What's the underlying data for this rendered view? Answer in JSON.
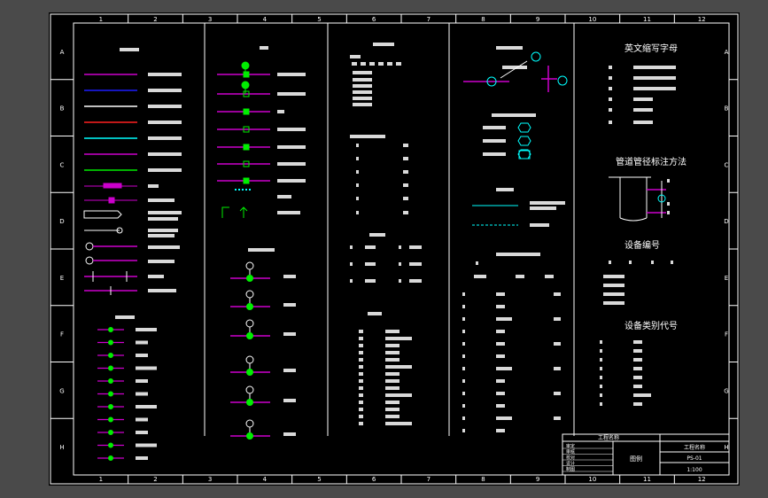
{
  "colors": {
    "background": "#000000",
    "frame": "#ffffff",
    "text": "#ffffff",
    "heading": "#ffffff",
    "magenta": "#cc00cc",
    "blue": "#1e1eff",
    "red": "#ff2020",
    "cyan": "#00ffff",
    "green": "#00ee00",
    "yellow": "#ffff00",
    "viewport": "#4a4a4a"
  },
  "frame": {
    "columns": [
      "1",
      "2",
      "3",
      "4",
      "5",
      "6",
      "7",
      "8",
      "9",
      "10",
      "11",
      "12"
    ],
    "rows": [
      "A",
      "B",
      "C",
      "D",
      "E",
      "F",
      "G",
      "H"
    ]
  },
  "sections": {
    "right_titles": [
      "英文缩写字母",
      "管道管径标注方法",
      "设备编号",
      "设备类别代号"
    ]
  },
  "title_block": {
    "rows": [
      {
        "label": "审定",
        "value": ""
      },
      {
        "label": "审核",
        "value": ""
      },
      {
        "label": "校对",
        "value": ""
      },
      {
        "label": "设计",
        "value": ""
      },
      {
        "label": "制图",
        "value": ""
      }
    ],
    "project": "工程名称",
    "drawing": "图例",
    "drawing_no": "PS-01",
    "scale": "1:100"
  }
}
